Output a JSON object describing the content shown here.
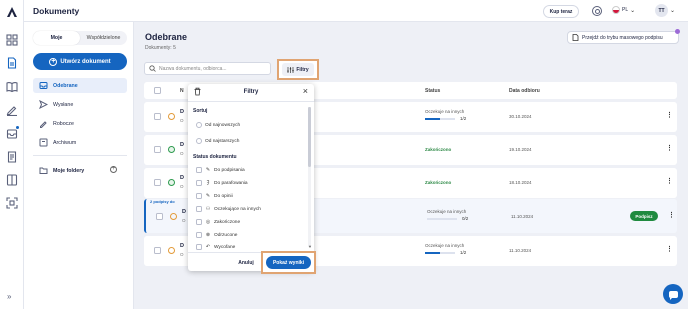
{
  "app": {
    "title": "Dokumenty"
  },
  "header": {
    "buy_label": "Kup teraz",
    "lang": "PL",
    "user_initials": "TT"
  },
  "sidebar": {
    "tabs": [
      "Moje",
      "Współdzielone"
    ],
    "upload_label": "Utwórz dokument",
    "items": [
      {
        "label": "Odebrane",
        "icon": "inbox-icon",
        "active": true
      },
      {
        "label": "Wysłane",
        "icon": "send-icon",
        "active": false
      },
      {
        "label": "Robocze",
        "icon": "pencil-icon",
        "active": false
      },
      {
        "label": "Archiwum",
        "icon": "archive-icon",
        "active": false
      }
    ],
    "folders_label": "Moje foldery"
  },
  "main": {
    "title": "Odebrane",
    "count": "Dokumenty: 5",
    "mass_sign_label": "Przejdź do trybu masowego podpisu",
    "search_placeholder": "Nazwa dokumentu, odbiorca...",
    "filter_label": "Filtry",
    "columns": {
      "name": "N",
      "status": "Status",
      "date": "Data odbioru"
    },
    "rows": [
      {
        "name": "D",
        "sub": "O",
        "status": "Oczekuje na innych",
        "progress": 0.5,
        "fraction": "1/2",
        "date": "30.10.2024",
        "state": "pending"
      },
      {
        "name": "D",
        "sub": "O",
        "status": "Zakończono",
        "date": "19.10.2024",
        "state": "done"
      },
      {
        "name": "D",
        "sub": "O",
        "status": "Zakończono",
        "date": "18.10.2024",
        "state": "done"
      },
      {
        "tag": "2 podpisy do",
        "name": "D",
        "sub": "O",
        "status": "Oczekuje na innych",
        "progress": 0.0,
        "fraction": "0/2",
        "date": "11.10.2024",
        "state": "pending",
        "action": "Podpisz"
      },
      {
        "name": "D",
        "sub": "O",
        "status": "Oczekuje na innych",
        "progress": 0.5,
        "fraction": "1/2",
        "date": "11.10.2024",
        "state": "pending"
      }
    ]
  },
  "filters": {
    "title": "Filtry",
    "sort_label": "Sortuj",
    "sort_options": [
      "Od najnowszych",
      "Od najstarszych"
    ],
    "status_label": "Status dokumentu",
    "status_options": [
      {
        "label": "Do podpisania",
        "icon": "pen-square-icon"
      },
      {
        "label": "Do parafowania",
        "icon": "initials-icon"
      },
      {
        "label": "Do opinii",
        "icon": "comment-icon"
      },
      {
        "label": "Oczekujące na innych",
        "icon": "users-icon"
      },
      {
        "label": "Zakończone",
        "icon": "check-circle-icon"
      },
      {
        "label": "Odrzucone",
        "icon": "x-circle-icon"
      },
      {
        "label": "Wycofane",
        "icon": "undo-icon"
      }
    ],
    "cancel_label": "Anuluj",
    "show_label": "Pokaż wyniki"
  },
  "colors": {
    "accent": "#1565c0",
    "success": "#1f8a3f",
    "highlight": "#e0a472"
  }
}
